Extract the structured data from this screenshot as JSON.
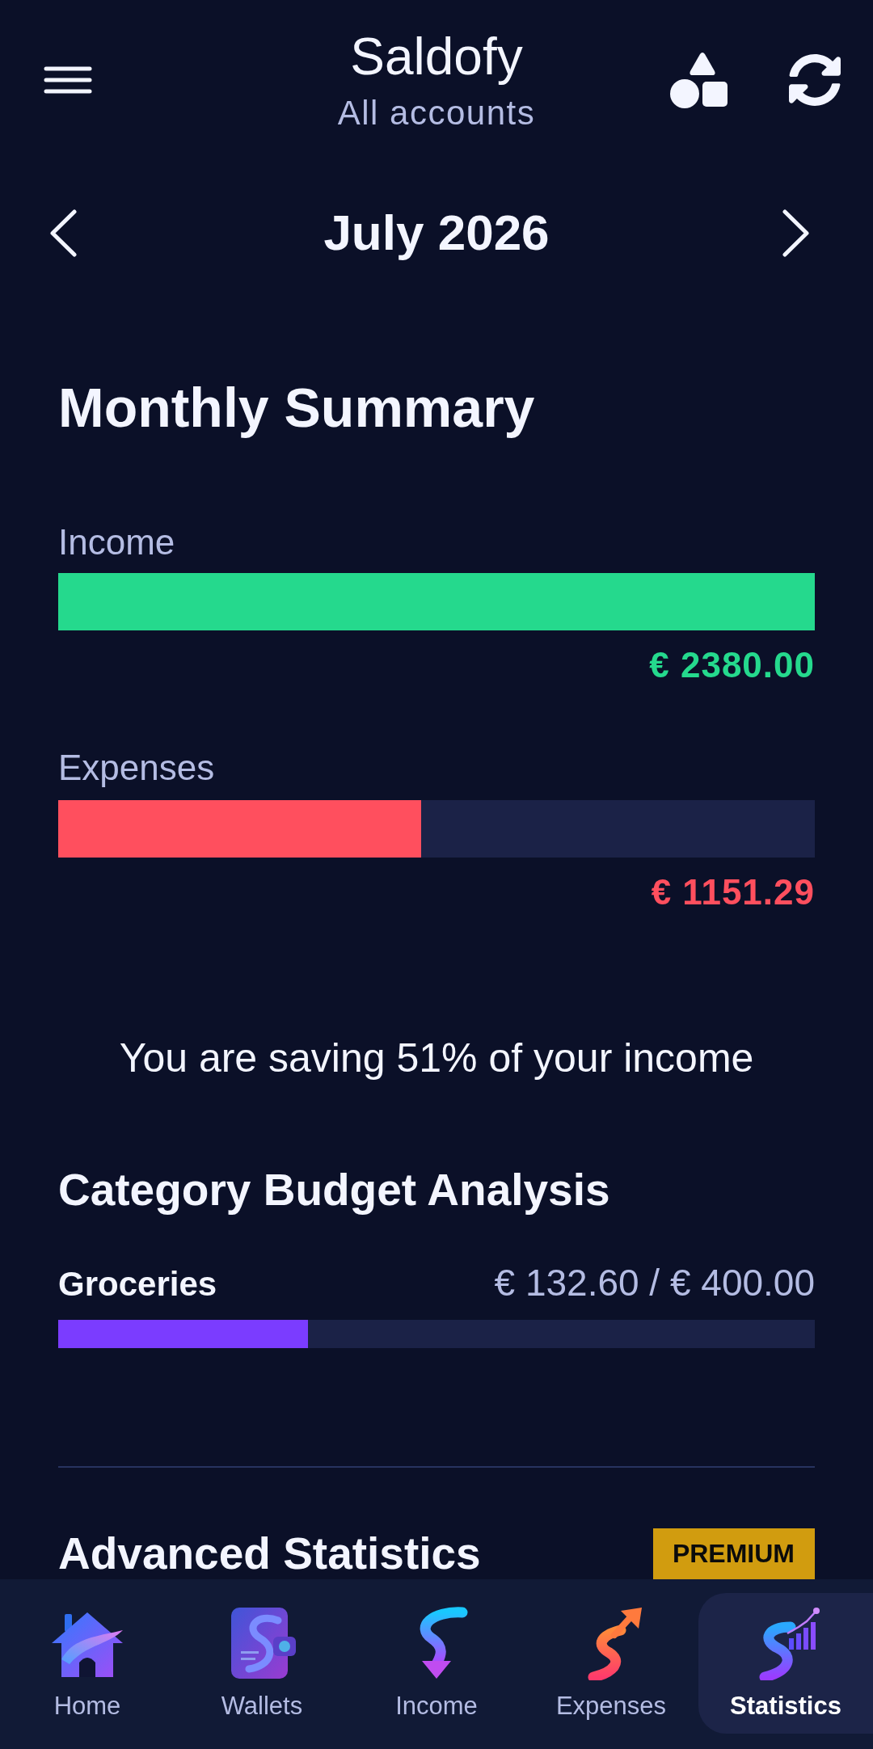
{
  "header": {
    "title": "Saldofy",
    "subtitle": "All accounts"
  },
  "month_nav": {
    "label": "July 2026"
  },
  "monthly_summary": {
    "title": "Monthly Summary",
    "rows": [
      {
        "kind": "income",
        "label": "Income",
        "level": 1,
        "amount": "€ 2380.00"
      },
      {
        "kind": "expense",
        "label": "Expenses",
        "level": 0.48,
        "amount": "€ 1151.29"
      }
    ]
  },
  "savings_message": "You are saving 51% of your income",
  "category_budget": {
    "title": "Category Budget Analysis",
    "items": [
      {
        "name": "Groceries",
        "amount": "€ 132.60 / € 400.00",
        "level": 0.33
      }
    ]
  },
  "advanced_statistics": {
    "title": "Advanced Statistics",
    "badge": "PREMIUM"
  },
  "bottom_nav": [
    {
      "kind": "home",
      "label": "Home",
      "selected": false
    },
    {
      "kind": "wallets",
      "label": "Wallets",
      "selected": false
    },
    {
      "kind": "income",
      "label": "Income",
      "selected": false
    },
    {
      "kind": "expenses",
      "label": "Expenses",
      "selected": false
    },
    {
      "kind": "statistics",
      "label": "Statistics",
      "selected": true
    }
  ]
}
